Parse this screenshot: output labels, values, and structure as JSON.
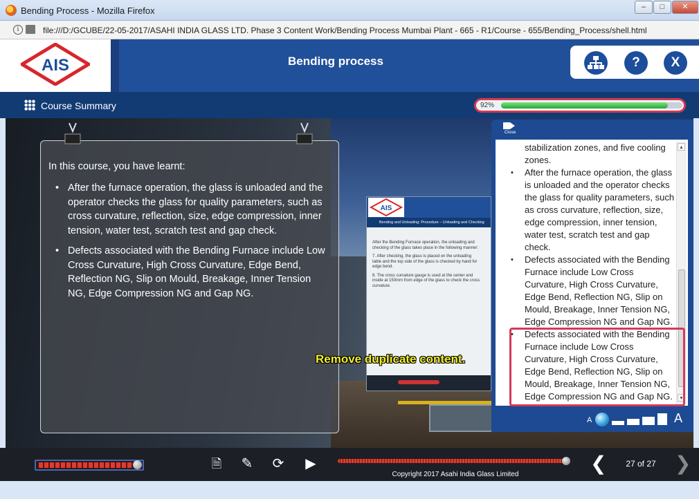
{
  "window": {
    "title": "Bending Process - Mozilla Firefox",
    "minimize_label": "–",
    "maximize_label": "□",
    "close_label": "✕"
  },
  "urlbar": {
    "url": "file:///D:/GCUBE/22-05-2017/ASAHI INDIA GLASS LTD. Phase 3 Content Work/Bending Process  Mumbai Plant - 665 - R1/Course - 655/Bending_Process/shell.html",
    "info_glyph": "i"
  },
  "header": {
    "logo_text": "AIS",
    "title": "Bending process",
    "buttons": {
      "map_glyph": "",
      "help_glyph": "?",
      "exit_glyph": "X"
    }
  },
  "subbar": {
    "course_summary_label": "Course Summary",
    "progress_label": "92%",
    "progress_value": 0.92
  },
  "summary": {
    "intro": "In this course, you have learnt:",
    "items": [
      "After the furnace operation, the glass is unloaded and the operator checks the glass for quality parameters, such as cross curvature, reflection, size, edge compression, inner tension, water test, scratch test and gap check.",
      "Defects associated with the Bending Furnace include Low Cross Curvature, High Cross Curvature, Edge Bend, Reflection NG, Slip on Mould, Breakage, Inner Tension NG, Edge Compression NG and Gap NG."
    ]
  },
  "inset": {
    "logo_text": "AIS",
    "subheader": "Bending and Unloading: Procedure – Unloading and Checking",
    "body_lines": [
      "After the Bending Furnace operation, the unloading and checking of the glass takes place in the following manner:",
      "7.  After checking, the glass is placed on the unloading table and the top side of the glass is checked by hand for edge bend.",
      "8.  The cross curvature gauge is used at the center and inside at 150mm from edge of the glass to check the cross curvature."
    ]
  },
  "review_note": "Remove duplicate content.",
  "transcript": {
    "close_label": "Close",
    "items": [
      {
        "text": "stabilization zones, and five cooling zones.",
        "bullet": false
      },
      {
        "text": "After the furnace operation, the glass is unloaded and the operator checks the glass for quality parameters, such as cross curvature, reflection, size, edge compression, inner tension, water test, scratch test and gap check.",
        "bullet": true
      },
      {
        "text": "Defects associated with the Bending Furnace include Low Cross Curvature, High Cross Curvature, Edge Bend, Reflection NG, Slip on Mould, Breakage, Inner Tension NG, Edge Compression NG and Gap NG.",
        "bullet": true
      },
      {
        "text": "Defects associated with the Bending Furnace include Low Cross Curvature, High Cross Curvature, Edge Bend, Reflection NG, Slip on Mould, Breakage, Inner Tension NG, Edge Compression NG and Gap NG.",
        "bullet": true
      }
    ],
    "font_small_label": "A",
    "font_large_label": "A"
  },
  "bottom": {
    "copyright": "Copyright 2017 Asahi India Glass Limited",
    "page_indicator": "27 of 27",
    "prev_glyph": "❮",
    "next_glyph": "❯",
    "play_glyph": "▶",
    "replay_glyph": "⟳",
    "pencil_glyph": "✎",
    "notes_glyph": "🗎"
  },
  "colors": {
    "brand_blue": "#21509b",
    "dark_blue": "#123b74",
    "highlight_red": "#d43a5a",
    "note_yellow": "#f5f02a"
  }
}
